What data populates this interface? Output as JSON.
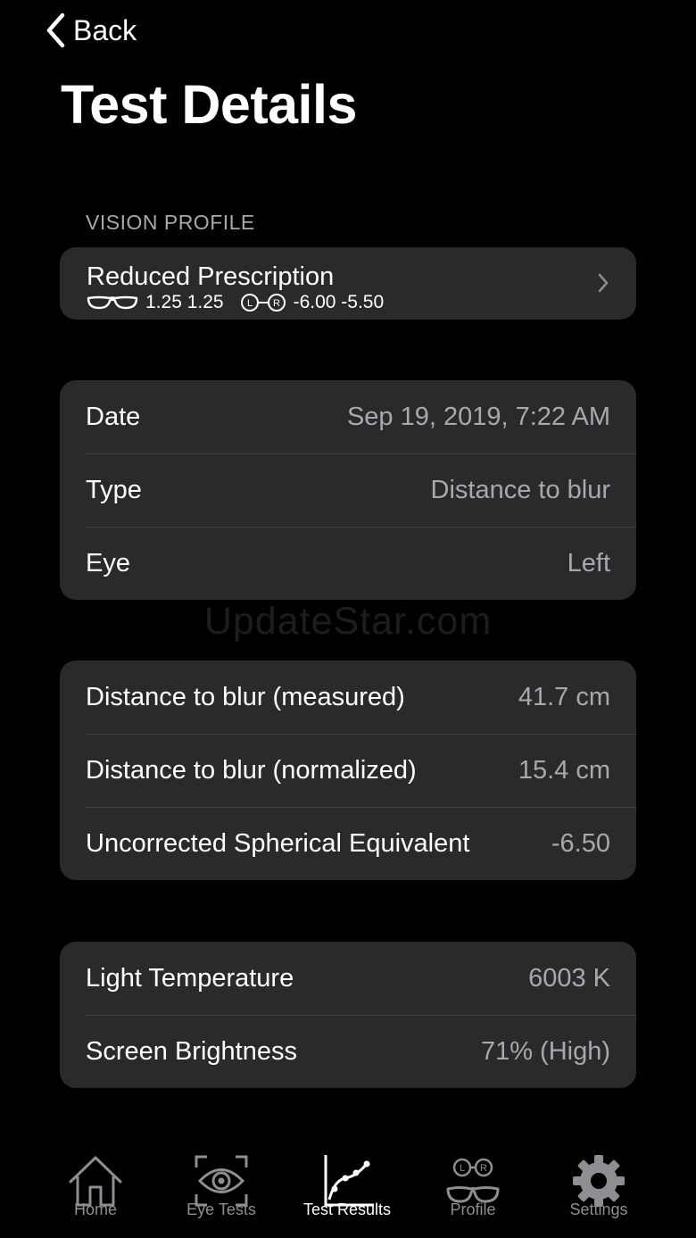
{
  "nav": {
    "back_label": "Back",
    "title": "Test Details"
  },
  "vision_profile": {
    "section_header": "VISION PROFILE",
    "name": "Reduced Prescription",
    "glasses_values": "1.25 1.25",
    "contacts_values": "-6.00 -5.50",
    "contacts_left_letter": "L",
    "contacts_right_letter": "R"
  },
  "info": {
    "rows": [
      {
        "label": "Date",
        "value": "Sep 19, 2019, 7:22 AM"
      },
      {
        "label": "Type",
        "value": "Distance to blur"
      },
      {
        "label": "Eye",
        "value": "Left"
      }
    ]
  },
  "measurements": {
    "rows": [
      {
        "label": "Distance to blur (measured)",
        "value": "41.7 cm"
      },
      {
        "label": "Distance to blur (normalized)",
        "value": "15.4 cm"
      },
      {
        "label": "Uncorrected Spherical Equivalent",
        "value": "-6.50"
      }
    ]
  },
  "environment": {
    "rows": [
      {
        "label": "Light Temperature",
        "value": "6003 K"
      },
      {
        "label": "Screen Brightness",
        "value": "71% (High)"
      }
    ]
  },
  "watermark": "UpdateStar.com",
  "tabbar": {
    "active_tab": "Test Results",
    "tabs": [
      {
        "label": "Home",
        "icon": "house-icon"
      },
      {
        "label": "Eye Tests",
        "icon": "eye-icon"
      },
      {
        "label": "Test Results",
        "icon": "chart-line-icon"
      },
      {
        "label": "Profile",
        "icon": "glasses-contacts-icon"
      },
      {
        "label": "Settings",
        "icon": "gear-icon"
      }
    ]
  },
  "colors": {
    "background": "#000000",
    "card": "#2a2a2c",
    "secondary_text": "#a8a8ad",
    "inactive_tab": "#8e8e93"
  }
}
